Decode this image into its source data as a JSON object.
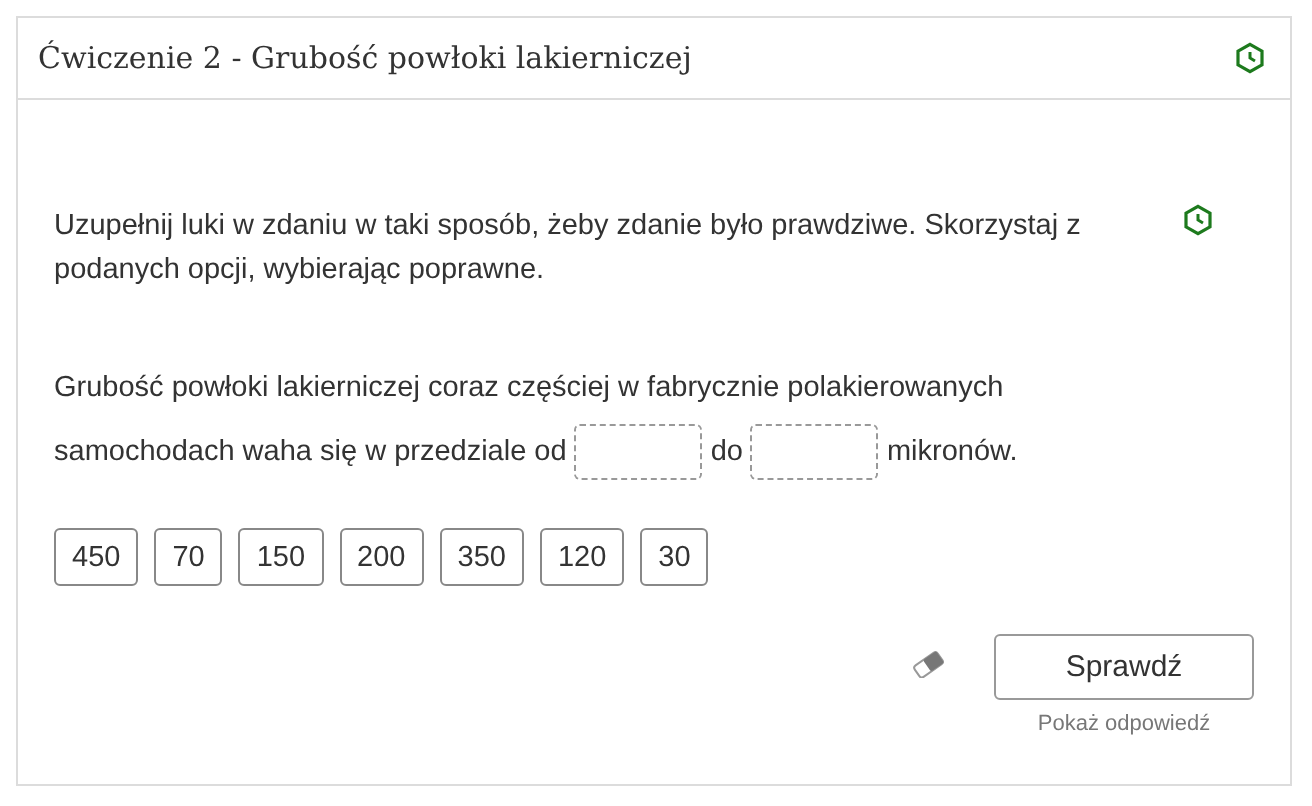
{
  "title": "Ćwiczenie 2 - Grubość powłoki lakierniczej",
  "instruction": "Uzupełnij luki w zdaniu w taki sposób, żeby zdanie było prawdziwe. Skorzystaj z podanych opcji, wybierając poprawne.",
  "sentence_lines": [
    [
      {
        "kind": "text",
        "text": "Grubość powłoki lakierniczej coraz częściej w fabrycznie polakierowanych"
      }
    ],
    [
      {
        "kind": "text",
        "text": "samochodach waha się w przedziale od"
      },
      {
        "kind": "gap"
      },
      {
        "kind": "text",
        "text": "do"
      },
      {
        "kind": "gap"
      },
      {
        "kind": "text",
        "text": "mikronów."
      }
    ]
  ],
  "options": [
    "450",
    "70",
    "150",
    "200",
    "350",
    "120",
    "30"
  ],
  "check_button": "Sprawdź",
  "show_answer": "Pokaż odpowiedź"
}
